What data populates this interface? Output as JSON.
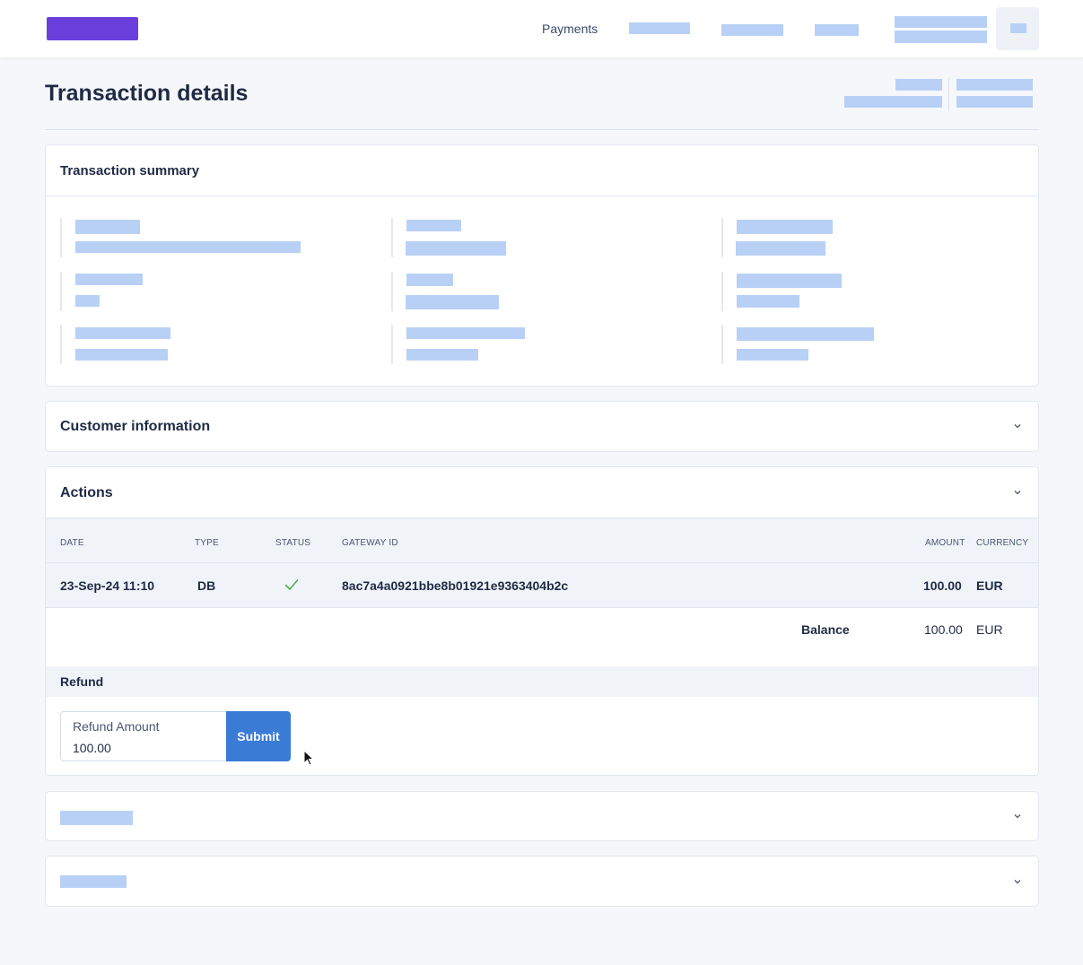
{
  "nav": {
    "payments_label": "Payments"
  },
  "page": {
    "title": "Transaction details"
  },
  "summary": {
    "title": "Transaction summary"
  },
  "customer": {
    "title": "Customer information"
  },
  "actions": {
    "title": "Actions",
    "columns": [
      "DATE",
      "TYPE",
      "STATUS",
      "GATEWAY ID",
      "AMOUNT",
      "CURRENCY"
    ],
    "rows": [
      {
        "date": "23-Sep-24 11:10",
        "type": "DB",
        "status_icon": "check-icon",
        "gateway_id": "8ac7a4a0921bbe8b01921e9363404b2c",
        "amount": "100.00",
        "currency": "EUR"
      }
    ],
    "balance": {
      "label": "Balance",
      "amount": "100.00",
      "currency": "EUR"
    },
    "refund": {
      "title": "Refund",
      "field_label": "Refund Amount",
      "field_value": "100.00",
      "submit_label": "Submit"
    }
  },
  "colors": {
    "brand": "#6a3fdb",
    "primary_button": "#3a7bd5",
    "success": "#4caf50",
    "placeholder": "#b8d0f5"
  }
}
